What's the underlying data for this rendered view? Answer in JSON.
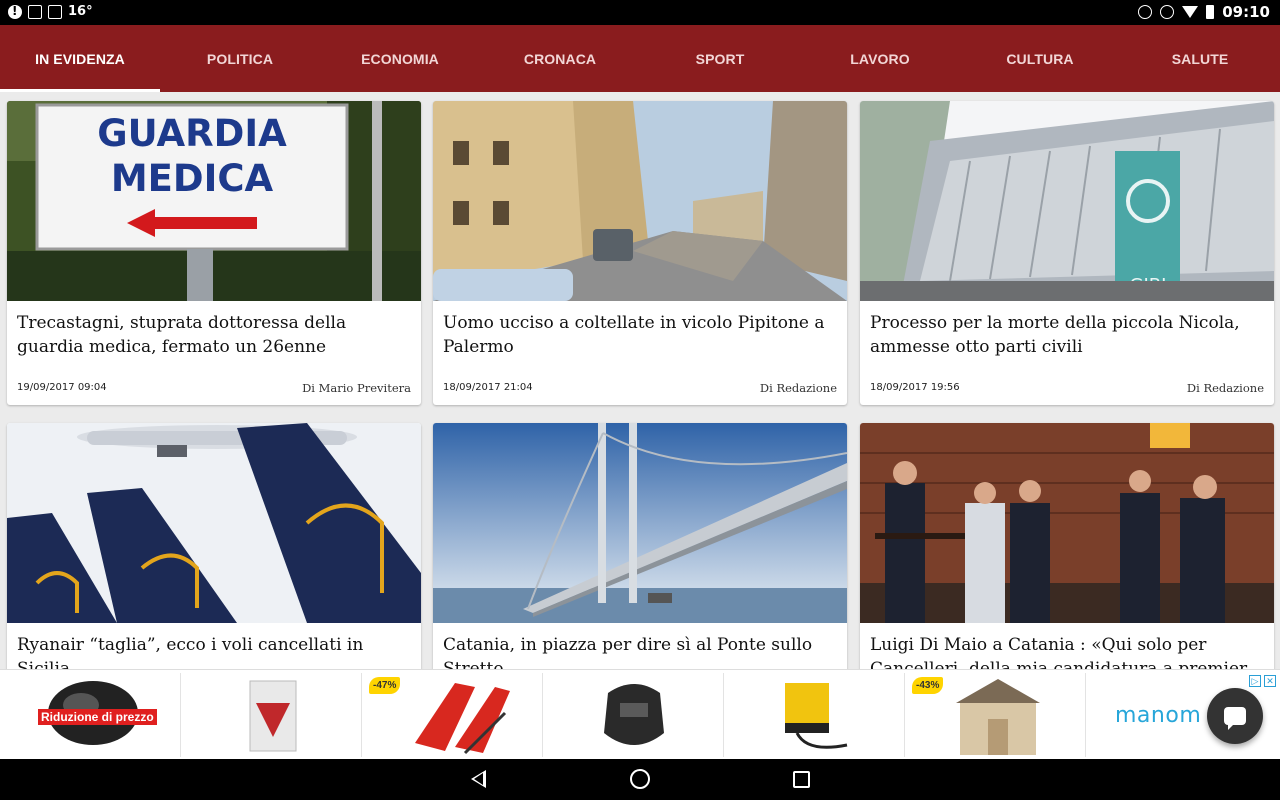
{
  "status_bar": {
    "temperature": "16°",
    "time": "09:10"
  },
  "nav": {
    "tabs": [
      {
        "label": "IN EVIDENZA"
      },
      {
        "label": "POLITICA"
      },
      {
        "label": "ECONOMIA"
      },
      {
        "label": "CRONACA"
      },
      {
        "label": "SPORT"
      },
      {
        "label": "LAVORO"
      },
      {
        "label": "CULTURA"
      },
      {
        "label": "SALUTE"
      }
    ]
  },
  "articles": [
    {
      "title": "Trecastagni, stuprata dottoressa della guardia medica, fermato un 26enne",
      "date": "19/09/2017 09:04",
      "author": "Di Mario Previtera",
      "sign_line1": "GUARDIA",
      "sign_line2": "MEDICA"
    },
    {
      "title": "Uomo ucciso a coltellate in vicolo Pipitone a Palermo",
      "date": "18/09/2017 21:04",
      "author": "Di Redazione"
    },
    {
      "title": "Processo per la morte della piccola Nicola, ammesse otto parti civili",
      "date": "18/09/2017 19:56",
      "author": "Di Redazione",
      "sign_text": "GIBI"
    },
    {
      "title": "Ryanair “taglia”, ecco i voli cancellati in Sicilia"
    },
    {
      "title": "Catania, in piazza per dire sì al Ponte sullo Stretto"
    },
    {
      "title": "Luigi Di Maio a Catania : «Qui solo per Cancelleri, della mia candidatura a premier"
    }
  ],
  "ads": {
    "items": [
      {
        "badge": "Riduzione di prezzo"
      },
      {
        "badge": ""
      },
      {
        "badge": "-47%"
      },
      {
        "badge": ""
      },
      {
        "badge": ""
      },
      {
        "badge": "-43%"
      }
    ],
    "brand_text": "manom"
  },
  "colors": {
    "header_bg": "#8a1c1e",
    "tab_active": "#ffffff",
    "tab_inactive": "#f2d6d6"
  }
}
